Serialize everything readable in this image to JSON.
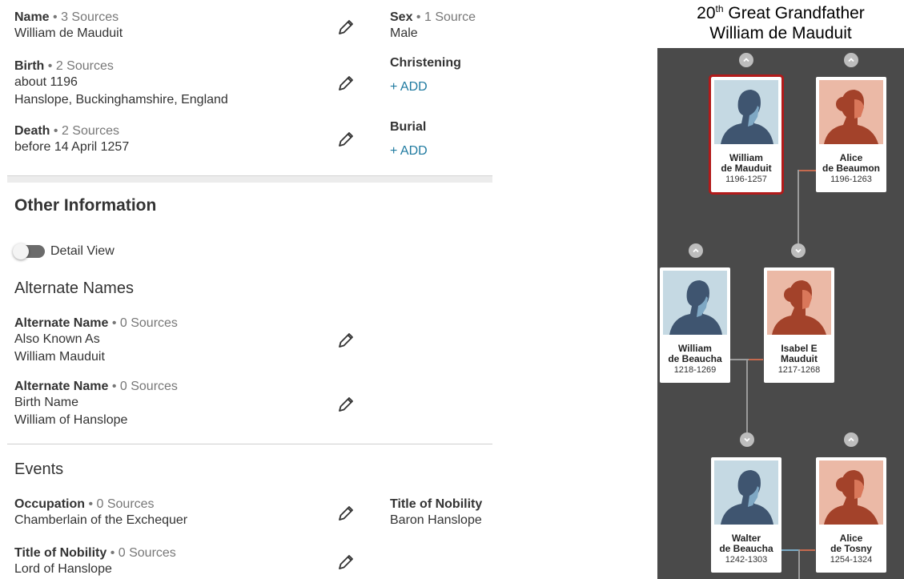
{
  "facts": {
    "name": {
      "label": "Name",
      "sources": "• 3 Sources",
      "value": "William de Mauduit"
    },
    "sex": {
      "label": "Sex",
      "sources": "• 1 Source",
      "value": "Male"
    },
    "birth": {
      "label": "Birth",
      "sources": "• 2 Sources",
      "date": "about 1196",
      "place": "Hanslope, Buckinghamshire, England"
    },
    "christening": {
      "label": "Christening",
      "add": "+  ADD"
    },
    "death": {
      "label": "Death",
      "sources": "• 2 Sources",
      "value": "before 14 April 1257"
    },
    "burial": {
      "label": "Burial",
      "add": "+  ADD"
    }
  },
  "other_information": {
    "heading": "Other Information",
    "detail_view_label": "Detail View",
    "alternate_names_heading": "Alternate Names",
    "alternate_names": [
      {
        "label": "Alternate Name",
        "sources": "• 0 Sources",
        "type": "Also Known As",
        "value": "William Mauduit"
      },
      {
        "label": "Alternate Name",
        "sources": "• 0 Sources",
        "type": "Birth Name",
        "value": "William of Hanslope"
      }
    ],
    "events_heading": "Events",
    "events": [
      {
        "label": "Occupation",
        "sources": "• 0 Sources",
        "value": "Chamberlain of the Exchequer"
      },
      {
        "label": "Title of Nobility",
        "sources": "• 0 Sources",
        "value": "Lord of Hanslope"
      }
    ],
    "title_of_nobility_side": {
      "label": "Title of Nobility",
      "value": "Baron Hanslope"
    }
  },
  "tree": {
    "title_num": "20",
    "title_sup": "th",
    "title_rest": " Great Grandfather",
    "title_name": "William de Mauduit",
    "cards": [
      {
        "first": "William",
        "last": "de Mauduit",
        "years": "1196-1257",
        "gender": "male",
        "selected": true
      },
      {
        "first": "Alice",
        "last": "de Beaumon",
        "years": "1196-1263",
        "gender": "female",
        "selected": false
      },
      {
        "first": "William",
        "last": "de Beaucha",
        "years": "1218-1269",
        "gender": "male",
        "selected": false
      },
      {
        "first": "Isabel E",
        "last": "Mauduit",
        "years": "1217-1268",
        "gender": "female",
        "selected": false
      },
      {
        "first": "Walter",
        "last": "de Beaucha",
        "years": "1242-1303",
        "gender": "male",
        "selected": false
      },
      {
        "first": "Alice",
        "last": "de Tosny",
        "years": "1254-1324",
        "gender": "female",
        "selected": false
      }
    ]
  },
  "colors": {
    "accent": "#1f7aa0",
    "selected": "#b21a1a",
    "panel": "#4a4a4a",
    "male_bg": "#c5d9e3",
    "female_bg": "#ebb9a6"
  },
  "icons": [
    "pencil-icon",
    "chevron-up-icon",
    "chevron-down-icon",
    "male-silhouette-icon",
    "female-silhouette-icon"
  ]
}
